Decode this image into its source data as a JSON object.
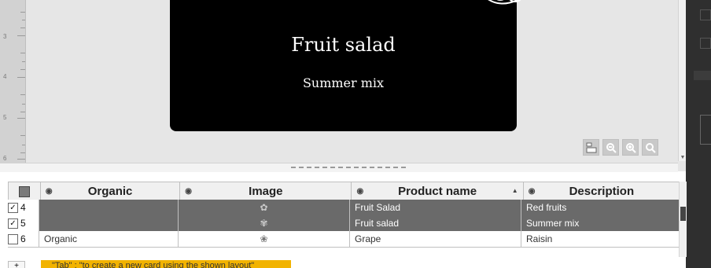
{
  "design": {
    "ruler_numbers": [
      "3",
      "4",
      "5",
      "6"
    ],
    "card": {
      "title": "Fruit salad",
      "subtitle": "Summer mix"
    },
    "zoom_tools": [
      {
        "icon": "layout-icon"
      },
      {
        "icon": "zoom-out-icon"
      },
      {
        "icon": "zoom-in-icon"
      },
      {
        "icon": "zoom-fit-icon"
      }
    ]
  },
  "table": {
    "columns": [
      {
        "name": "Organic"
      },
      {
        "name": "Image"
      },
      {
        "name": "Product name"
      },
      {
        "name": "Description"
      }
    ],
    "rows": [
      {
        "row_number": "4",
        "checked": true,
        "organic": "",
        "image_icon": "fruit-thumbnail",
        "product_name": "Fruit Salad",
        "description": "Red fruits"
      },
      {
        "row_number": "5",
        "checked": true,
        "organic": "",
        "image_icon": "fruit-thumbnail",
        "product_name": "Fruit salad",
        "description": "Summer mix"
      },
      {
        "row_number": "6",
        "checked": false,
        "organic": "Organic",
        "image_icon": "fruit-thumbnail",
        "product_name": "Grape",
        "description": "Raisin"
      }
    ]
  },
  "footer": {
    "tip": "\"Tab\" : \"to create a new card using the shown layout\""
  }
}
